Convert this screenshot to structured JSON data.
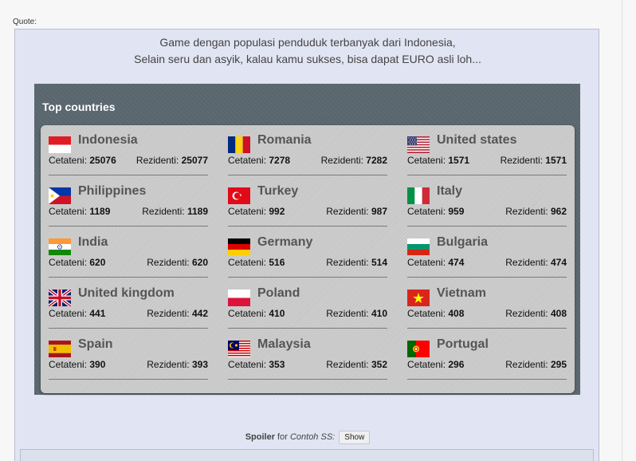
{
  "quote_label": "Quote:",
  "intro": {
    "line1": "Game dengan populasi penduduk terbanyak dari Indonesia,",
    "line2": "Selain seru dan asyik, kalau kamu sukses, bisa dapat EURO asli loh..."
  },
  "panel_title": "Top countries",
  "countries": [
    {
      "name": "Indonesia",
      "flag": "indonesia-flag-icon",
      "cetateni_label": "Cetateni:",
      "cetateni": "25076",
      "rezidenti_label": "Rezidenti:",
      "rezidenti": "25077"
    },
    {
      "name": "Romania",
      "flag": "romania-flag-icon",
      "cetateni_label": "Cetateni:",
      "cetateni": "7278",
      "rezidenti_label": "Rezidenti:",
      "rezidenti": "7282"
    },
    {
      "name": "United states",
      "flag": "usa-flag-icon",
      "cetateni_label": "Cetateni:",
      "cetateni": "1571",
      "rezidenti_label": "Rezidenti:",
      "rezidenti": "1571"
    },
    {
      "name": "Philippines",
      "flag": "philippines-flag-icon",
      "cetateni_label": "Cetateni:",
      "cetateni": "1189",
      "rezidenti_label": "Rezidenti:",
      "rezidenti": "1189"
    },
    {
      "name": "Turkey",
      "flag": "turkey-flag-icon",
      "cetateni_label": "Cetateni:",
      "cetateni": "992",
      "rezidenti_label": "Rezidenti:",
      "rezidenti": "987"
    },
    {
      "name": "Italy",
      "flag": "italy-flag-icon",
      "cetateni_label": "Cetateni:",
      "cetateni": "959",
      "rezidenti_label": "Rezidenti:",
      "rezidenti": "962"
    },
    {
      "name": "India",
      "flag": "india-flag-icon",
      "cetateni_label": "Cetateni:",
      "cetateni": "620",
      "rezidenti_label": "Rezidenti:",
      "rezidenti": "620"
    },
    {
      "name": "Germany",
      "flag": "germany-flag-icon",
      "cetateni_label": "Cetateni:",
      "cetateni": "516",
      "rezidenti_label": "Rezidenti:",
      "rezidenti": "514"
    },
    {
      "name": "Bulgaria",
      "flag": "bulgaria-flag-icon",
      "cetateni_label": "Cetateni:",
      "cetateni": "474",
      "rezidenti_label": "Rezidenti:",
      "rezidenti": "474"
    },
    {
      "name": "United kingdom",
      "flag": "uk-flag-icon",
      "cetateni_label": "Cetateni:",
      "cetateni": "441",
      "rezidenti_label": "Rezidenti:",
      "rezidenti": "442"
    },
    {
      "name": "Poland",
      "flag": "poland-flag-icon",
      "cetateni_label": "Cetateni:",
      "cetateni": "410",
      "rezidenti_label": "Rezidenti:",
      "rezidenti": "410"
    },
    {
      "name": "Vietnam",
      "flag": "vietnam-flag-icon",
      "cetateni_label": "Cetateni:",
      "cetateni": "408",
      "rezidenti_label": "Rezidenti:",
      "rezidenti": "408"
    },
    {
      "name": "Spain",
      "flag": "spain-flag-icon",
      "cetateni_label": "Cetateni:",
      "cetateni": "390",
      "rezidenti_label": "Rezidenti:",
      "rezidenti": "393"
    },
    {
      "name": "Malaysia",
      "flag": "malaysia-flag-icon",
      "cetateni_label": "Cetateni:",
      "cetateni": "353",
      "rezidenti_label": "Rezidenti:",
      "rezidenti": "352"
    },
    {
      "name": "Portugal",
      "flag": "portugal-flag-icon",
      "cetateni_label": "Cetateni:",
      "cetateni": "296",
      "rezidenti_label": "Rezidenti:",
      "rezidenti": "295"
    }
  ],
  "spoiler": {
    "label": "Spoiler",
    "for_text": " for ",
    "title": "Contoh SS:",
    "button": "Show"
  },
  "colors": {
    "quote_bg": "#e1e4f2",
    "panel_bg": "#5c6870",
    "card_bg": "#cdcdcd",
    "country_name": "#555555"
  }
}
